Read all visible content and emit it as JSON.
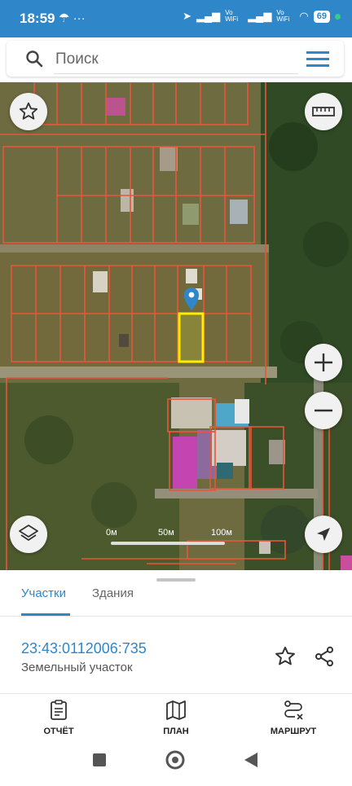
{
  "status_bar": {
    "time": "18:59",
    "left_icons": "☂ ···",
    "signal_text_1": "Vo WiFi",
    "signal_text_2": "Vo WiFi",
    "battery": "69"
  },
  "search": {
    "placeholder": "Поиск"
  },
  "map": {
    "scale_labels": [
      "0м",
      "50м",
      "100м"
    ]
  },
  "sheet": {
    "tabs": [
      "Участки",
      "Здания"
    ],
    "active_tab": "Участки",
    "parcel_id": "23:43:0112006:735",
    "parcel_type": "Земельный участок"
  },
  "bottom_nav": {
    "items": [
      {
        "label": "ОТЧЁТ",
        "icon": "report-icon"
      },
      {
        "label": "ПЛАН",
        "icon": "map-plan-icon"
      },
      {
        "label": "МАРШРУТ",
        "icon": "route-icon"
      }
    ]
  },
  "colors": {
    "accent": "#2f86c9",
    "parcel_border": "#e8553a",
    "selected_parcel": "#ffee00",
    "marker": "#2f86c9"
  }
}
